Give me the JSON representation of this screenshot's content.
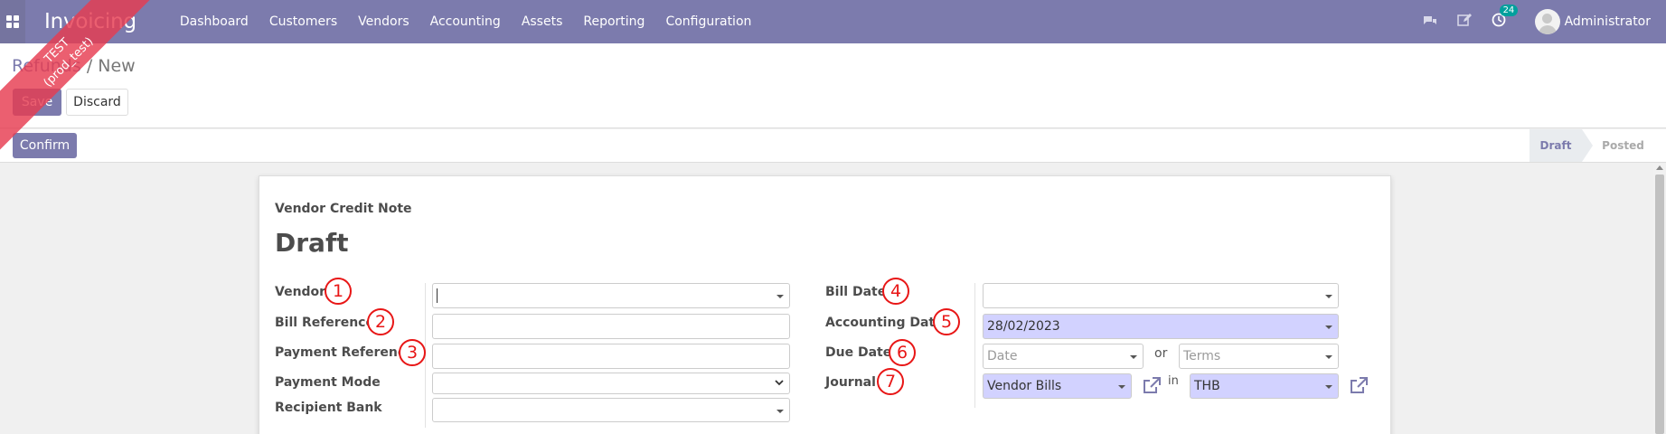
{
  "app": {
    "name": "Invoicing",
    "menu": [
      "Dashboard",
      "Customers",
      "Vendors",
      "Accounting",
      "Assets",
      "Reporting",
      "Configuration"
    ],
    "notification_count": "24",
    "user": "Administrator",
    "ribbon": {
      "line1": "TEST",
      "line2": "(prod_test)"
    }
  },
  "breadcrumb": {
    "parent": "Refunds",
    "separator": " / ",
    "current": "New"
  },
  "buttons": {
    "save": "Save",
    "discard": "Discard",
    "confirm": "Confirm"
  },
  "status": {
    "stages": [
      "Draft",
      "Posted"
    ],
    "active": "Draft"
  },
  "form": {
    "subtitle": "Vendor Credit Note",
    "title": "Draft",
    "left": {
      "vendor_label": "Vendor",
      "vendor_value": "",
      "bill_reference_label": "Bill Reference",
      "payment_reference_label": "Payment Reference",
      "payment_mode_label": "Payment Mode",
      "recipient_bank_label": "Recipient Bank"
    },
    "right": {
      "bill_date_label": "Bill Date",
      "bill_date_value": "",
      "accounting_date_label": "Accounting Date",
      "accounting_date_value": "28/02/2023",
      "due_date_label": "Due Date",
      "due_date_placeholder": "Date",
      "or": "or",
      "terms_placeholder": "Terms",
      "journal_label": "Journal",
      "journal_value": "Vendor Bills",
      "in": "in",
      "currency_value": "THB"
    }
  },
  "annotations": [
    "1",
    "2",
    "3",
    "4",
    "5",
    "6",
    "7"
  ],
  "colors": {
    "navbar": "#7c7bad",
    "required_field": "#d2d2ff",
    "annotation": "#e81616",
    "ribbon": "#e63c50"
  }
}
